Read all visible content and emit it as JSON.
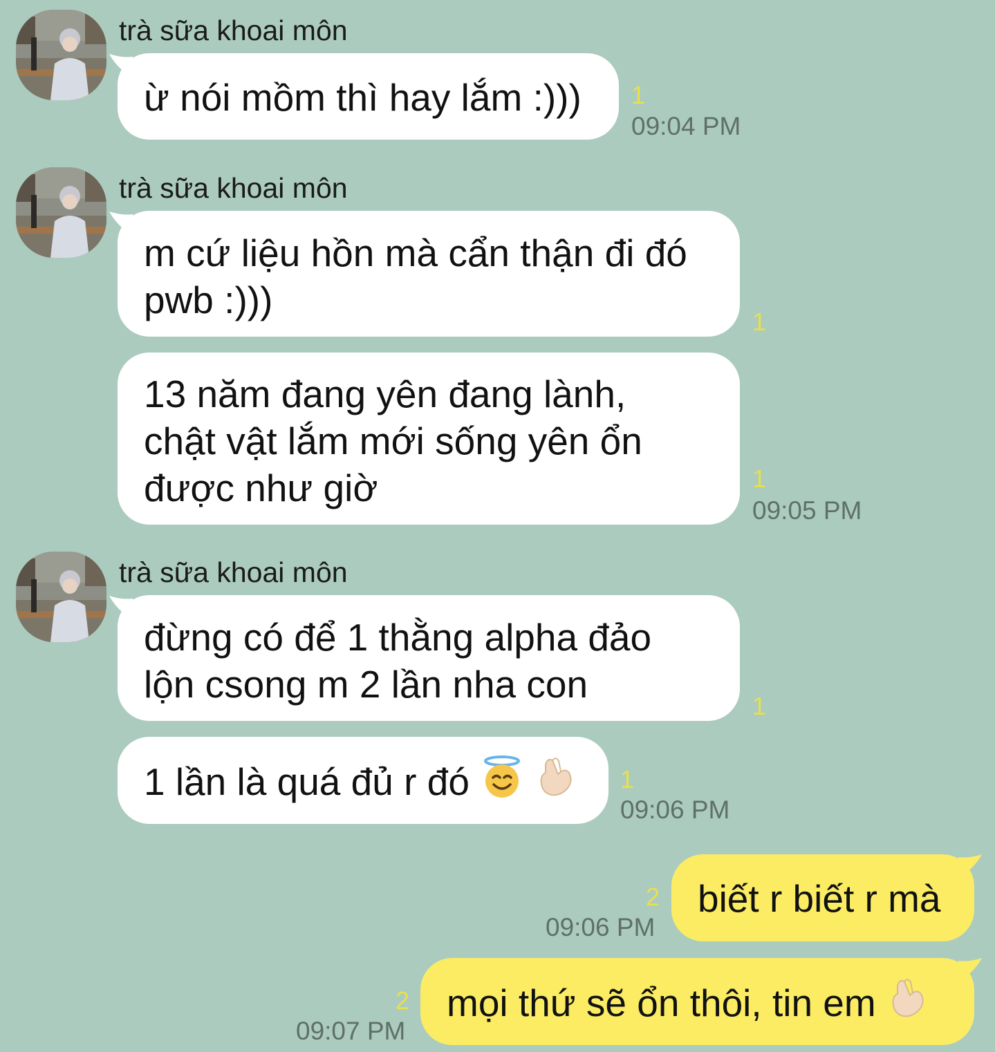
{
  "contact": {
    "name": "trà sữa khoai môn"
  },
  "messages": [
    {
      "text": "ừ nói mồm thì hay lắm :)))",
      "count": "1",
      "time": "09:04 PM"
    },
    {
      "line1": "m cứ liệu hồn mà cẩn thận đi đó",
      "line2": "pwb :)))",
      "count": "1"
    },
    {
      "line1": "13 năm đang yên đang lành,",
      "line2": "chật vật lắm mới sống yên ổn",
      "line3": "được như giờ",
      "count": "1",
      "time": "09:05 PM"
    },
    {
      "line1": "đừng có để 1 thằng alpha đảo",
      "line2": "lộn csong m 2 lần nha con",
      "count": "1"
    },
    {
      "text": "1 lần là quá đủ r đó",
      "count": "1",
      "time": "09:06 PM",
      "emojis": [
        "smiling-face-with-halo-icon",
        "crossed-fingers-heart-icon"
      ]
    }
  ],
  "outgoing": [
    {
      "text": "biết r biết r mà",
      "count": "2",
      "time": "09:06 PM"
    },
    {
      "text": "mọi thứ sẽ ổn thôi, tin em",
      "count": "2",
      "time": "09:07 PM",
      "emojis": [
        "crossed-fingers-heart-icon"
      ]
    }
  ],
  "colors": {
    "background": "#abcbbf",
    "incoming_bubble": "#ffffff",
    "outgoing_bubble": "#fbec64",
    "unread_count": "#e9df4e",
    "timestamp": "#5f6f69"
  }
}
